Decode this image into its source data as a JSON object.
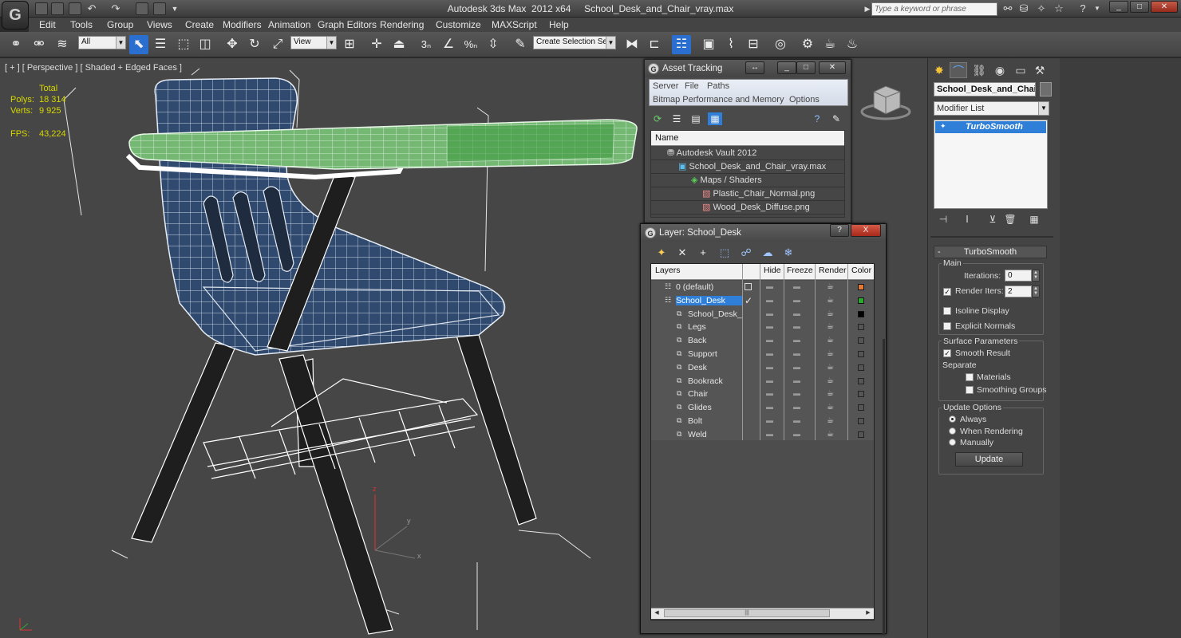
{
  "window": {
    "title": "Autodesk 3ds Max  2012 x64     School_Desk_and_Chair_vray.max",
    "search_placeholder": "Type a keyword or phrase"
  },
  "menu": [
    "Edit",
    "Tools",
    "Group",
    "Views",
    "Create",
    "Modifiers",
    "Animation",
    "Graph Editors",
    "Rendering",
    "Customize",
    "MAXScript",
    "Help"
  ],
  "toolbar": {
    "filter_value": "All",
    "ref_coord_value": "View",
    "selection_set_value": "Create Selection Se"
  },
  "viewport": {
    "label": "[ + ] [ Perspective ] [ Shaded + Edged Faces ]",
    "stats": {
      "total_label": "Total",
      "polys_label": "Polys:",
      "polys_value": "18 314",
      "verts_label": "Verts:",
      "verts_value": "9 925",
      "fps_label": "FPS:",
      "fps_value": "43,224"
    },
    "axis_labels": {
      "z": "z",
      "y": "y",
      "x": "x"
    }
  },
  "asset_tracking": {
    "title": "Asset Tracking",
    "menu_row1": [
      "Server",
      "File",
      "Paths"
    ],
    "menu_row2": [
      "Bitmap Performance and Memory",
      "Options"
    ],
    "column_header": "Name",
    "tree": [
      {
        "label": "Autodesk Vault 2012",
        "level": 0
      },
      {
        "label": "School_Desk_and_Chair_vray.max",
        "level": 1
      },
      {
        "label": "Maps / Shaders",
        "level": 2
      },
      {
        "label": "Plastic_Chair_Normal.png",
        "level": 3
      },
      {
        "label": "Wood_Desk_Diffuse.png",
        "level": 3
      }
    ]
  },
  "layer_dialog": {
    "title": "Layer: School_Desk",
    "help_label": "?",
    "close_label": "X",
    "columns": [
      "Layers",
      "Hide",
      "Freeze",
      "Render",
      "Color"
    ],
    "layers": [
      {
        "name": "0 (default)",
        "color": "#e07838",
        "indent": 0,
        "selected": false,
        "checkbox": true
      },
      {
        "name": "School_Desk",
        "color": "#2ca82c",
        "indent": 0,
        "selected": true,
        "checkbox": false
      },
      {
        "name": "School_Desk_and",
        "color": "#000000",
        "indent": 1,
        "selected": false,
        "checkbox": false
      },
      {
        "name": "Legs",
        "color": "",
        "indent": 1,
        "selected": false,
        "checkbox": false
      },
      {
        "name": "Back",
        "color": "",
        "indent": 1,
        "selected": false,
        "checkbox": false
      },
      {
        "name": "Support",
        "color": "",
        "indent": 1,
        "selected": false,
        "checkbox": false
      },
      {
        "name": "Desk",
        "color": "",
        "indent": 1,
        "selected": false,
        "checkbox": false
      },
      {
        "name": "Bookrack",
        "color": "",
        "indent": 1,
        "selected": false,
        "checkbox": false
      },
      {
        "name": "Chair",
        "color": "",
        "indent": 1,
        "selected": false,
        "checkbox": false
      },
      {
        "name": "Glides",
        "color": "",
        "indent": 1,
        "selected": false,
        "checkbox": false
      },
      {
        "name": "Bolt",
        "color": "",
        "indent": 1,
        "selected": false,
        "checkbox": false
      },
      {
        "name": "Weld",
        "color": "",
        "indent": 1,
        "selected": false,
        "checkbox": false
      }
    ]
  },
  "command_panel": {
    "object_name": "School_Desk_and_Chair",
    "modifier_list_label": "Modifier List",
    "stack_item": "TurboSmooth",
    "rollout_title": "TurboSmooth",
    "main_label": "Main",
    "iterations_label": "Iterations:",
    "iterations_value": "0",
    "render_iters_label": "Render Iters:",
    "render_iters_value": "2",
    "isoline_label": "Isoline Display",
    "explicit_normals_label": "Explicit Normals",
    "surface_params_label": "Surface Parameters",
    "smooth_result_label": "Smooth Result",
    "separate_label": "Separate",
    "materials_label": "Materials",
    "smoothing_groups_label": "Smoothing Groups",
    "update_options_label": "Update Options",
    "always_label": "Always",
    "when_rendering_label": "When Rendering",
    "manually_label": "Manually",
    "update_button": "Update"
  }
}
